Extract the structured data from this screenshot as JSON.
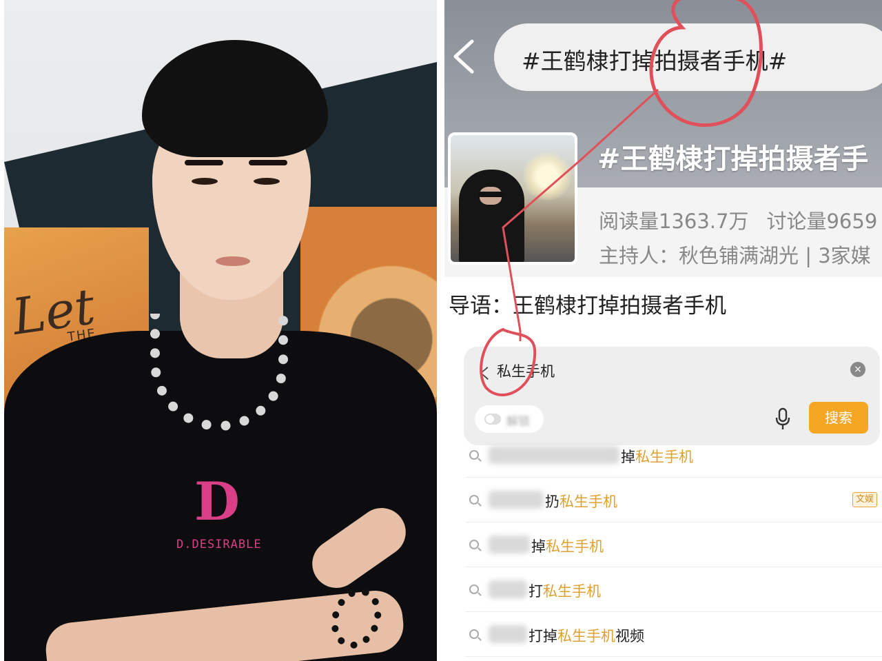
{
  "photo": {
    "poster_text": "Let",
    "poster_small": "THE",
    "shirt_logo_letter": "D",
    "shirt_logo_text": "D.DESIRABLE"
  },
  "screen": {
    "top_search": "#王鹤棣打掉拍摄者手机#",
    "topic": {
      "title": "#王鹤棣打掉拍摄者手",
      "stats_read": "阅读量1363.7万",
      "stats_discuss": "讨论量9659",
      "host": "主持人：秋色铺满湖光 | 3家媒"
    },
    "guide": "导语：王鹤棣打掉拍摄者手机",
    "search": {
      "back": "く",
      "input": "私生手机",
      "clear": "×",
      "toggle_label": "解锁",
      "button": "搜索"
    },
    "suggestions": [
      {
        "prefix": "掉",
        "highlight": "私生手机",
        "suffix": "",
        "badge": ""
      },
      {
        "prefix": "扔",
        "highlight": "私生手机",
        "suffix": "",
        "badge": "文娱"
      },
      {
        "prefix": "掉",
        "highlight": "私生手机",
        "suffix": "",
        "badge": ""
      },
      {
        "prefix": "打",
        "highlight": "私生手机",
        "suffix": "",
        "badge": ""
      },
      {
        "prefix": "打掉",
        "highlight": "私生手机",
        "suffix": "视频",
        "badge": ""
      }
    ],
    "colors": {
      "accent": "#f5a623",
      "highlight": "#e0a030",
      "annotation": "#e0505a"
    }
  }
}
